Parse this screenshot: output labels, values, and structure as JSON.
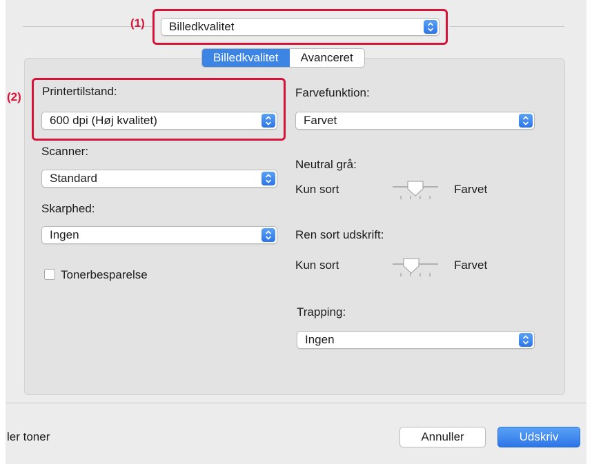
{
  "callouts": {
    "one": "(1)",
    "two": "(2)"
  },
  "panel_selector": {
    "value": "Billedkvalitet"
  },
  "tabs": [
    {
      "label": "Billedkvalitet",
      "active": true
    },
    {
      "label": "Avanceret",
      "active": false
    }
  ],
  "left_column": {
    "printer_mode": {
      "label": "Printertilstand:",
      "value": "600 dpi (Høj kvalitet)"
    },
    "scanner": {
      "label": "Scanner:",
      "value": "Standard"
    },
    "sharpness": {
      "label": "Skarphed:",
      "value": "Ingen"
    },
    "toner_save": {
      "label": "Tonerbesparelse",
      "checked": false
    }
  },
  "right_column": {
    "color_mode": {
      "label": "Farvefunktion:",
      "value": "Farvet"
    },
    "neutral_gray": {
      "label": "Neutral grå:",
      "left_label": "Kun sort",
      "right_label": "Farvet",
      "level": 0.5
    },
    "pure_black": {
      "label": "Ren sort udskrift:",
      "left_label": "Kun sort",
      "right_label": "Farvet",
      "level": 0.4
    },
    "trapping": {
      "label": "Trapping:",
      "value": "Ingen"
    }
  },
  "footer": {
    "cut_text": "ler toner",
    "cancel_label": "Annuller",
    "print_label": "Udskriv"
  },
  "colors": {
    "accent": "#3d85e4",
    "callout": "#d6143a"
  },
  "icons": [
    "stepper-icon",
    "checkbox",
    "slider-thumb-icon"
  ]
}
